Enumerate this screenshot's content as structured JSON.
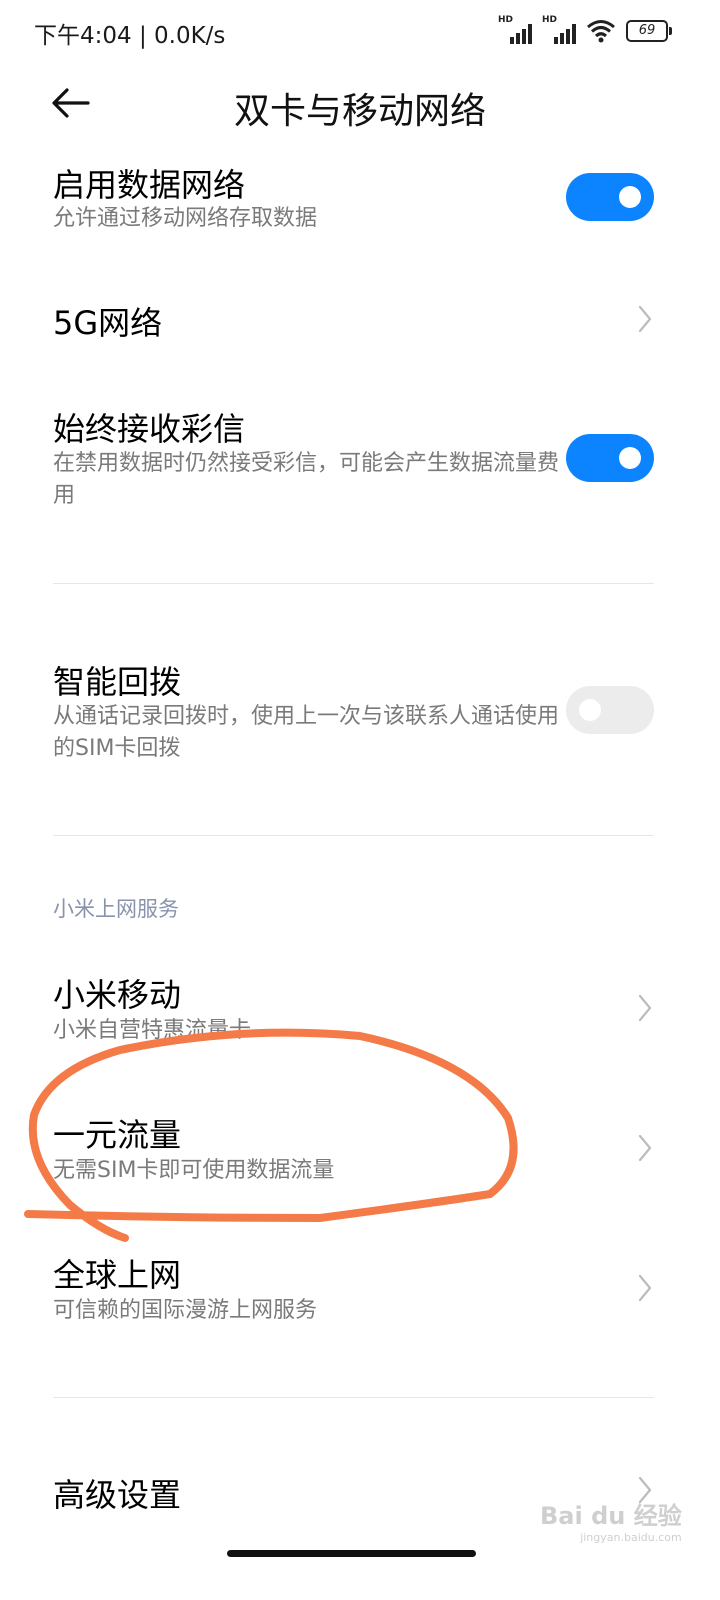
{
  "status_bar": {
    "time": "下午4:04 | 0.0K/s",
    "signal_badge": "HD",
    "battery": "69"
  },
  "header": {
    "title": "双卡与移动网络",
    "back_icon": "back-arrow-icon"
  },
  "settings": {
    "data_network": {
      "title": "启用数据网络",
      "subtitle": "允许通过移动网络存取数据",
      "enabled": true
    },
    "network_5g": {
      "title": "5G网络"
    },
    "always_mms": {
      "title": "始终接收彩信",
      "subtitle": "在禁用数据时仍然接受彩信，可能会产生数据流量费用",
      "enabled": true
    },
    "smart_redial": {
      "title": "智能回拨",
      "subtitle": "从通话记录回拨时，使用上一次与该联系人通话使用的SIM卡回拨",
      "enabled": false
    }
  },
  "services": {
    "section_label": "小米上网服务",
    "xiaomi_mobile": {
      "title": "小米移动",
      "subtitle": "小米自营特惠流量卡"
    },
    "one_yuan": {
      "title": "一元流量",
      "subtitle": "无需SIM卡即可使用数据流量"
    },
    "global_net": {
      "title": "全球上网",
      "subtitle": "可信赖的国际漫游上网服务"
    }
  },
  "advanced": {
    "title": "高级设置"
  },
  "watermark": {
    "brand": "Bai du 经验",
    "url": "jingyan.baidu.com"
  },
  "colors": {
    "accent": "#0d84ff",
    "annotation": "#f47a48",
    "section": "#8a93ad"
  }
}
